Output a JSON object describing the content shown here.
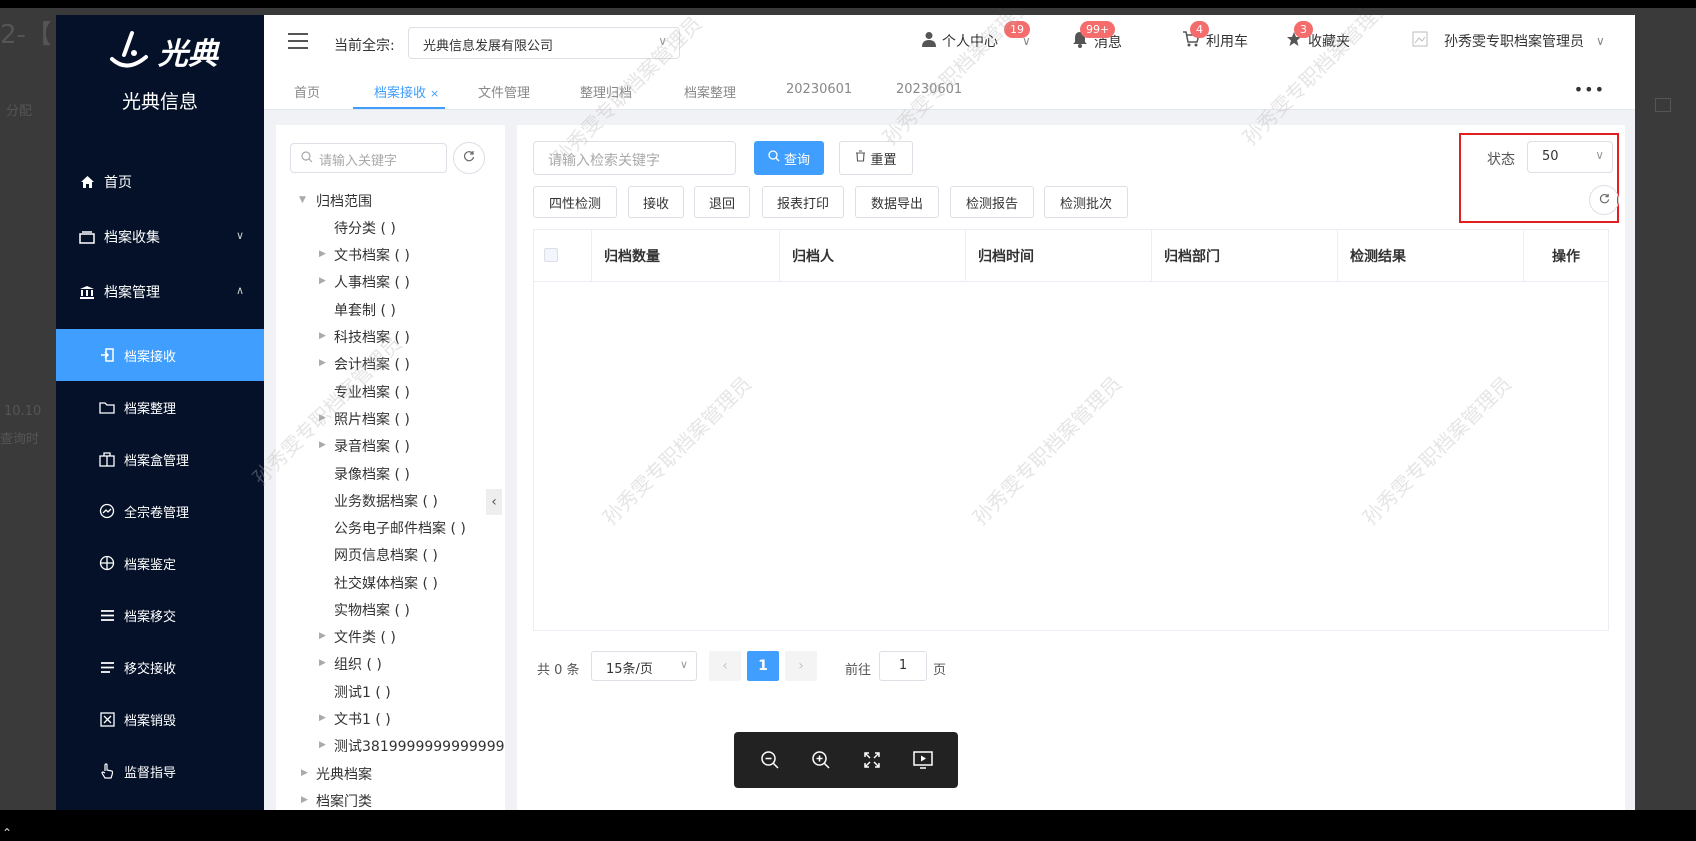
{
  "backdrop": {
    "left_text_1": "2-【",
    "left_text_2": "分配",
    "left_text_3": "10.10",
    "left_text_4": "查询时"
  },
  "sidebar": {
    "logo_text": "光典",
    "company_name": "光典信息",
    "items": [
      {
        "label": "首页",
        "icon": "home-icon"
      },
      {
        "label": "档案收集",
        "icon": "folder-stack-icon"
      },
      {
        "label": "档案管理",
        "icon": "bank-icon"
      },
      {
        "label": "档案接收",
        "icon": "receive-icon"
      },
      {
        "label": "档案整理",
        "icon": "folder-icon"
      },
      {
        "label": "档案盒管理",
        "icon": "box-icon"
      },
      {
        "label": "全宗卷管理",
        "icon": "gauge-icon"
      },
      {
        "label": "档案鉴定",
        "icon": "crosshair-icon"
      },
      {
        "label": "档案移交",
        "icon": "list-icon"
      },
      {
        "label": "移交接收",
        "icon": "list-check-icon"
      },
      {
        "label": "档案销毁",
        "icon": "destroy-icon"
      },
      {
        "label": "监督指导",
        "icon": "hand-pointer-icon"
      }
    ]
  },
  "header": {
    "fonds_label": "当前全宗:",
    "fonds_value": "光典信息发展有限公司",
    "personal_center": "个人中心",
    "personal_badge": "19",
    "messages": "消息",
    "messages_badge": "99+",
    "cart": "利用车",
    "cart_badge": "4",
    "favorites": "收藏夹",
    "favorites_badge": "3",
    "user_name": "孙秀雯专职档案管理员"
  },
  "tabs": [
    {
      "label": "首页"
    },
    {
      "label": "档案接收"
    },
    {
      "label": "文件管理"
    },
    {
      "label": "整理归档"
    },
    {
      "label": "档案整理"
    },
    {
      "label": "20230601"
    },
    {
      "label": "20230601"
    }
  ],
  "tabs_more": "•••",
  "tree": {
    "search_placeholder": "请输入关键字",
    "nodes": [
      {
        "label": "归档范围"
      },
      {
        "label": "待分类 ( )"
      },
      {
        "label": "文书档案 ( )"
      },
      {
        "label": "人事档案 ( )"
      },
      {
        "label": "单套制 ( )"
      },
      {
        "label": "科技档案 ( )"
      },
      {
        "label": "会计档案 ( )"
      },
      {
        "label": "专业档案 ( )"
      },
      {
        "label": "照片档案 ( )"
      },
      {
        "label": "录音档案 ( )"
      },
      {
        "label": "录像档案 ( )"
      },
      {
        "label": "业务数据档案 ( )"
      },
      {
        "label": "公务电子邮件档案 ( )"
      },
      {
        "label": "网页信息档案 ( )"
      },
      {
        "label": "社交媒体档案 ( )"
      },
      {
        "label": "实物档案 ( )"
      },
      {
        "label": "文件类 ( )"
      },
      {
        "label": "组织 ( )"
      },
      {
        "label": "测试1 ( )"
      },
      {
        "label": "文书1 ( )"
      },
      {
        "label": "测试3819999999999999"
      },
      {
        "label": "光典档案"
      },
      {
        "label": "档案门类"
      }
    ]
  },
  "main": {
    "search_placeholder": "请输入检索关键字",
    "query_button": "查询",
    "reset_button": "重置",
    "actions": [
      "四性检测",
      "接收",
      "退回",
      "报表打印",
      "数据导出",
      "检测报告",
      "检测批次"
    ],
    "status_label": "状态",
    "status_value": "50",
    "columns": [
      "归档数量",
      "归档人",
      "归档时间",
      "归档部门",
      "检测结果",
      "操作"
    ]
  },
  "pagination": {
    "total": "共 0 条",
    "page_size": "15条/页",
    "current_page": "1",
    "goto_label": "前往",
    "goto_value": "1",
    "page_suffix": "页"
  },
  "watermark": "孙秀雯专职档案管理员",
  "colors": {
    "sidebar_bg": "#041129",
    "accent": "#409eff",
    "badge": "#f56c6c",
    "highlight_border": "#e02020"
  }
}
